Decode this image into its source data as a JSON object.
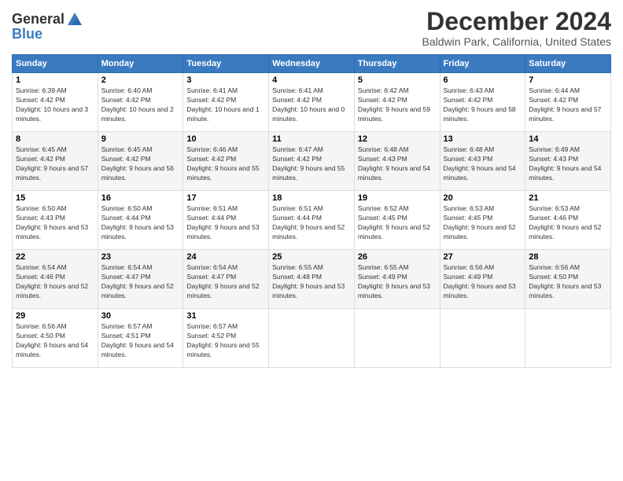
{
  "logo": {
    "general": "General",
    "blue": "Blue"
  },
  "header": {
    "title": "December 2024",
    "subtitle": "Baldwin Park, California, United States"
  },
  "weekdays": [
    "Sunday",
    "Monday",
    "Tuesday",
    "Wednesday",
    "Thursday",
    "Friday",
    "Saturday"
  ],
  "weeks": [
    [
      {
        "day": "1",
        "sunrise": "6:39 AM",
        "sunset": "4:42 PM",
        "daylight": "10 hours and 3 minutes."
      },
      {
        "day": "2",
        "sunrise": "6:40 AM",
        "sunset": "4:42 PM",
        "daylight": "10 hours and 2 minutes."
      },
      {
        "day": "3",
        "sunrise": "6:41 AM",
        "sunset": "4:42 PM",
        "daylight": "10 hours and 1 minute."
      },
      {
        "day": "4",
        "sunrise": "6:41 AM",
        "sunset": "4:42 PM",
        "daylight": "10 hours and 0 minutes."
      },
      {
        "day": "5",
        "sunrise": "6:42 AM",
        "sunset": "4:42 PM",
        "daylight": "9 hours and 59 minutes."
      },
      {
        "day": "6",
        "sunrise": "6:43 AM",
        "sunset": "4:42 PM",
        "daylight": "9 hours and 58 minutes."
      },
      {
        "day": "7",
        "sunrise": "6:44 AM",
        "sunset": "4:42 PM",
        "daylight": "9 hours and 57 minutes."
      }
    ],
    [
      {
        "day": "8",
        "sunrise": "6:45 AM",
        "sunset": "4:42 PM",
        "daylight": "9 hours and 57 minutes."
      },
      {
        "day": "9",
        "sunrise": "6:45 AM",
        "sunset": "4:42 PM",
        "daylight": "9 hours and 56 minutes."
      },
      {
        "day": "10",
        "sunrise": "6:46 AM",
        "sunset": "4:42 PM",
        "daylight": "9 hours and 55 minutes."
      },
      {
        "day": "11",
        "sunrise": "6:47 AM",
        "sunset": "4:42 PM",
        "daylight": "9 hours and 55 minutes."
      },
      {
        "day": "12",
        "sunrise": "6:48 AM",
        "sunset": "4:43 PM",
        "daylight": "9 hours and 54 minutes."
      },
      {
        "day": "13",
        "sunrise": "6:48 AM",
        "sunset": "4:43 PM",
        "daylight": "9 hours and 54 minutes."
      },
      {
        "day": "14",
        "sunrise": "6:49 AM",
        "sunset": "4:43 PM",
        "daylight": "9 hours and 54 minutes."
      }
    ],
    [
      {
        "day": "15",
        "sunrise": "6:50 AM",
        "sunset": "4:43 PM",
        "daylight": "9 hours and 53 minutes."
      },
      {
        "day": "16",
        "sunrise": "6:50 AM",
        "sunset": "4:44 PM",
        "daylight": "9 hours and 53 minutes."
      },
      {
        "day": "17",
        "sunrise": "6:51 AM",
        "sunset": "4:44 PM",
        "daylight": "9 hours and 53 minutes."
      },
      {
        "day": "18",
        "sunrise": "6:51 AM",
        "sunset": "4:44 PM",
        "daylight": "9 hours and 52 minutes."
      },
      {
        "day": "19",
        "sunrise": "6:52 AM",
        "sunset": "4:45 PM",
        "daylight": "9 hours and 52 minutes."
      },
      {
        "day": "20",
        "sunrise": "6:53 AM",
        "sunset": "4:45 PM",
        "daylight": "9 hours and 52 minutes."
      },
      {
        "day": "21",
        "sunrise": "6:53 AM",
        "sunset": "4:46 PM",
        "daylight": "9 hours and 52 minutes."
      }
    ],
    [
      {
        "day": "22",
        "sunrise": "6:54 AM",
        "sunset": "4:46 PM",
        "daylight": "9 hours and 52 minutes."
      },
      {
        "day": "23",
        "sunrise": "6:54 AM",
        "sunset": "4:47 PM",
        "daylight": "9 hours and 52 minutes."
      },
      {
        "day": "24",
        "sunrise": "6:54 AM",
        "sunset": "4:47 PM",
        "daylight": "9 hours and 52 minutes."
      },
      {
        "day": "25",
        "sunrise": "6:55 AM",
        "sunset": "4:48 PM",
        "daylight": "9 hours and 53 minutes."
      },
      {
        "day": "26",
        "sunrise": "6:55 AM",
        "sunset": "4:49 PM",
        "daylight": "9 hours and 53 minutes."
      },
      {
        "day": "27",
        "sunrise": "6:56 AM",
        "sunset": "4:49 PM",
        "daylight": "9 hours and 53 minutes."
      },
      {
        "day": "28",
        "sunrise": "6:56 AM",
        "sunset": "4:50 PM",
        "daylight": "9 hours and 53 minutes."
      }
    ],
    [
      {
        "day": "29",
        "sunrise": "6:56 AM",
        "sunset": "4:50 PM",
        "daylight": "9 hours and 54 minutes."
      },
      {
        "day": "30",
        "sunrise": "6:57 AM",
        "sunset": "4:51 PM",
        "daylight": "9 hours and 54 minutes."
      },
      {
        "day": "31",
        "sunrise": "6:57 AM",
        "sunset": "4:52 PM",
        "daylight": "9 hours and 55 minutes."
      },
      null,
      null,
      null,
      null
    ]
  ]
}
